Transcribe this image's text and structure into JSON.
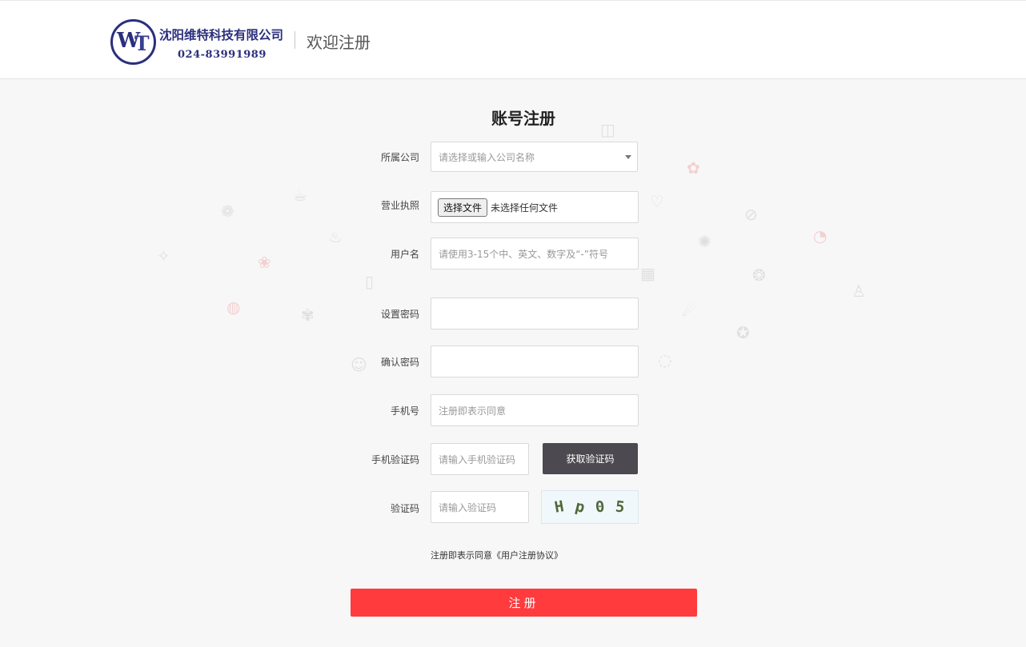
{
  "header": {
    "company_name": "沈阳维特科技有限公司",
    "phone": "024-83991989",
    "welcome": "欢迎注册",
    "logo_text": {
      "w": "W",
      "t": "T"
    }
  },
  "form": {
    "title": "账号注册",
    "company": {
      "label": "所属公司",
      "placeholder": "请选择或输入公司名称"
    },
    "license": {
      "label": "营业执照",
      "button": "选择文件",
      "status": "未选择任何文件"
    },
    "username": {
      "label": "用户名",
      "placeholder": "请使用3-15个中、英文、数字及“-”符号"
    },
    "password": {
      "label": "设置密码",
      "value": ""
    },
    "confirm_password": {
      "label": "确认密码",
      "value": ""
    },
    "phone": {
      "label": "手机号",
      "placeholder": "注册即表示同意"
    },
    "sms_code": {
      "label": "手机验证码",
      "placeholder": "请输入手机验证码",
      "button": "获取验证码"
    },
    "captcha": {
      "label": "验证码",
      "placeholder": "请输入验证码",
      "chars": [
        "H",
        "p",
        "0",
        "5"
      ]
    },
    "agreement": {
      "prefix": "注册即表示同意",
      "link": "《用户注册协议》"
    },
    "submit": "注册"
  },
  "colors": {
    "brand": "#2b2f7d",
    "submit": "#ff3b3e",
    "code_button": "#4c4a50"
  }
}
